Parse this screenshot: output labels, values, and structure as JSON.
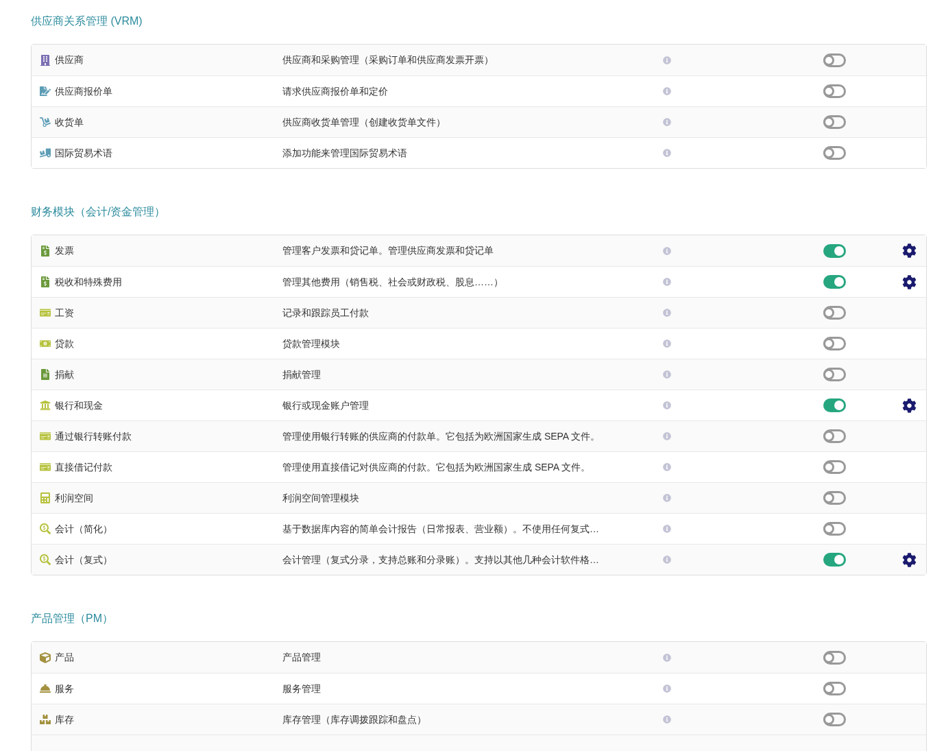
{
  "sections": [
    {
      "title": "供应商关系管理 (VRM)",
      "rows": [
        {
          "name": "供应商",
          "description": "供应商和采购管理（采购订单和供应商发票开票）",
          "on": false
        },
        {
          "name": "供应商报价单",
          "description": "请求供应商报价单和定价",
          "on": false
        },
        {
          "name": "收货单",
          "description": "供应商收货单管理（创建收货单文件）",
          "on": false
        },
        {
          "name": "国际贸易术语",
          "description": "添加功能来管理国际贸易术语",
          "on": false
        }
      ]
    },
    {
      "title": "财务模块（会计/资金管理）",
      "rows": [
        {
          "name": "发票",
          "description": "管理客户发票和贷记单。管理供应商发票和贷记单",
          "on": true
        },
        {
          "name": "税收和特殊费用",
          "description": "管理其他费用（销售税、社会或财政税、股息……）",
          "on": true
        },
        {
          "name": "工资",
          "description": "记录和跟踪员工付款",
          "on": false
        },
        {
          "name": "贷款",
          "description": "贷款管理模块",
          "on": false
        },
        {
          "name": "捐献",
          "description": "捐献管理",
          "on": false
        },
        {
          "name": "银行和现金",
          "description": "银行或现金账户管理",
          "on": true
        },
        {
          "name": "通过银行转账付款",
          "description": "管理使用银行转账的供应商的付款单。它包括为欧洲国家生成 SEPA 文件。",
          "on": false
        },
        {
          "name": "直接借记付款",
          "description": "管理使用直接借记对供应商的付款。它包括为欧洲国家生成 SEPA 文件。",
          "on": false
        },
        {
          "name": "利润空间",
          "description": "利润空间管理模块",
          "on": false
        },
        {
          "name": "会计（简化）",
          "description": "基于数据库内容的简单会计报告（日常报表、营业额）。不使用任何复式…",
          "on": false
        },
        {
          "name": "会计（复式）",
          "description": "会计管理（复式分录，支持总账和分录账）。支持以其他几种会计软件格…",
          "on": true
        }
      ]
    },
    {
      "title": "产品管理（PM）",
      "rows": [
        {
          "name": "产品",
          "description": "产品管理",
          "on": false
        },
        {
          "name": "服务",
          "description": "服务管理",
          "on": false
        },
        {
          "name": "库存",
          "description": "库存管理（库存调拨跟踪和盘点）",
          "on": false
        }
      ]
    }
  ]
}
